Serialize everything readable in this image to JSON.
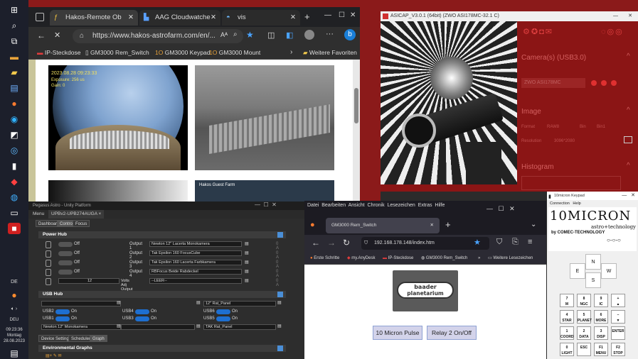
{
  "taskbar": {
    "lang": "DE",
    "lang2": "DEU",
    "time": "09:23:36",
    "day": "Montag",
    "date": "28.08.2023"
  },
  "edge": {
    "tabs": [
      {
        "label": "Hakos-Remote Ob"
      },
      {
        "label": "AAG Cloudwatche"
      },
      {
        "label": "vis"
      }
    ],
    "url": "https://www.hakos-astrofarm.com/en/...",
    "reader": "Aᴬ",
    "favorites": [
      {
        "label": "IP-Steckdose"
      },
      {
        "label": "GM3000 Rem_Switch"
      },
      {
        "label": "GM3000 Keypad"
      },
      {
        "label": "GM3000 Mount"
      }
    ],
    "favorites_more": "Weitere Favoriten",
    "cam1_overlay": "2023.08.28 09:23:33",
    "cam1_overlay2": "Exposure: 256 us",
    "cam1_overlay3": "Gain: 0",
    "cam4_overlay": "Hakos Guest Farm"
  },
  "asi": {
    "title": "ASICAP_V3.0.1 (64bit) (ZWO ASI178MC-32.1 C)",
    "camera_header": "Camera(s) (USB3.0)",
    "camera": "ZWO ASI178MC",
    "image_header": "Image",
    "format_label": "Format",
    "format_value": "RAW8",
    "bin_label": "Bin",
    "bin_value": "Bin1",
    "resolution_label": "Resolution",
    "resolution_value": "3096*2080",
    "histogram_header": "Histogram"
  },
  "hub": {
    "title": "Pegasus Astro - Unity Platform",
    "menu": "Menu",
    "device_tab": "UPBv2-UPB274AUGA",
    "tabs": [
      {
        "label": "Dashboard"
      },
      {
        "label": "Control"
      },
      {
        "label": "Focus"
      }
    ],
    "power_section": "Power Hub",
    "outputs": [
      {
        "state": "Off",
        "label": "Output 1",
        "name": "Newton 12\" Lacerta Monokamera",
        "amps": "0 A"
      },
      {
        "state": "Off",
        "label": "Output 2",
        "name": "Tak Epsilon 160 FocusCube",
        "amps": "0 A"
      },
      {
        "state": "Off",
        "label": "Output 3",
        "name": "Tak Epsilon 160 Lacerta Farbkamera",
        "amps": "0 A"
      },
      {
        "state": "Off",
        "label": "Output 4",
        "name": "RBFocus Beide Rabdeckel",
        "amps": "0 A"
      }
    ],
    "volts": "12",
    "volts_label": "Volts Adj Output",
    "adj_name": "--LEER--",
    "adj_amps": "0 A",
    "usb_section": "USB Hub",
    "usb_name_top": "12\" Rat_Panel",
    "usb": [
      {
        "label": "USB2",
        "state": "On"
      },
      {
        "label": "USB4",
        "state": "On"
      },
      {
        "label": "USB6",
        "state": "On"
      },
      {
        "label": "USB1",
        "state": "On"
      },
      {
        "label": "USB3",
        "state": "On"
      },
      {
        "label": "USB5",
        "state": "On"
      }
    ],
    "usb_name1": "Newton 12\" Monokamera",
    "usb_name2": "TAK Rat_Panel",
    "bottom_tabs": [
      {
        "label": "Device Settings"
      },
      {
        "label": "Scheduler"
      },
      {
        "label": "Graph"
      }
    ],
    "env_section": "Environmental Graphs"
  },
  "firefox": {
    "menu": [
      {
        "label": "Datei"
      },
      {
        "label": "Bearbeiten"
      },
      {
        "label": "Ansicht"
      },
      {
        "label": "Chronik"
      },
      {
        "label": "Lesezeichen"
      },
      {
        "label": "Extras"
      },
      {
        "label": "Hilfe"
      }
    ],
    "tab": "GM3000 Rem_Switch",
    "url": "192.168.178.148/index.htm",
    "bookmarks": [
      {
        "label": "Erste Schritte"
      },
      {
        "label": "my.AnyDesk"
      },
      {
        "label": "IP-Steckdose"
      },
      {
        "label": "GM3000 Rem_Switch"
      }
    ],
    "bookmarks_more": "Weitere Lesezeichen",
    "logo_line1": "baader",
    "logo_line2": "planetarium",
    "btn1": "10 Micron Pulse",
    "btn2": "Relay 2 On/Off"
  },
  "keypad": {
    "title": "10micron Keypad",
    "menu_connection": "Connection",
    "menu_help": "Help",
    "logo_main": "10MICRON",
    "logo_sub": "astro+technology",
    "logo_by": "by COMEC-TECHNOLOGY",
    "dir_n": "N",
    "dir_e": "E",
    "dir_w": "W",
    "dir_s": "S",
    "keys": [
      {
        "n": "7",
        "l": "M"
      },
      {
        "n": "8",
        "l": "NGC"
      },
      {
        "n": "9",
        "l": "IC"
      },
      {
        "n": "+",
        "l": "▲"
      },
      {
        "n": "4",
        "l": "STAR"
      },
      {
        "n": "5",
        "l": "PLANET"
      },
      {
        "n": "6",
        "l": "MORE"
      },
      {
        "n": "–",
        "l": "▼"
      },
      {
        "n": "1",
        "l": "COORD"
      },
      {
        "n": "2",
        "l": "DATA"
      },
      {
        "n": "3",
        "l": "DISP"
      },
      {
        "n": "",
        "l": "ENTER"
      },
      {
        "n": "0",
        "l": "LIGHT"
      },
      {
        "n": "",
        "l": "ESC"
      },
      {
        "n": "F1",
        "l": "MENU"
      },
      {
        "n": "F2",
        "l": "STOP"
      }
    ]
  }
}
